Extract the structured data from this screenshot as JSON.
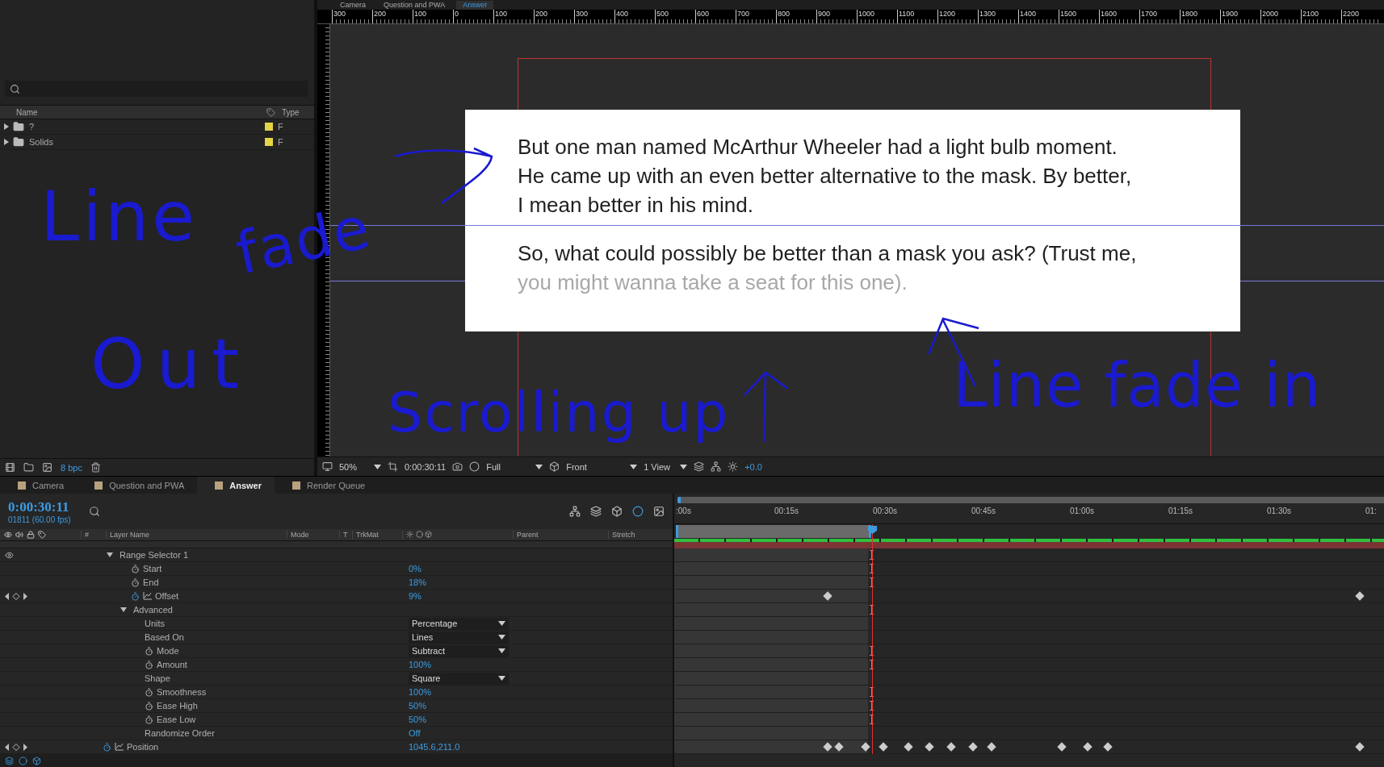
{
  "project": {
    "columns": [
      {
        "label": "Name"
      },
      {
        "label": "Type"
      }
    ],
    "items": [
      {
        "name": "?",
        "type": "F",
        "expanded": false
      },
      {
        "name": "Solids",
        "type": "F",
        "expanded": false
      }
    ],
    "bit_depth": "8 bpc"
  },
  "viewer": {
    "tabs": [
      {
        "label": "Camera",
        "selected": false
      },
      {
        "label": "Question and PWA",
        "selected": false
      },
      {
        "label": "Answer",
        "selected": true
      }
    ],
    "ruler": [
      "300",
      "200",
      "100",
      "0",
      "100",
      "200",
      "300",
      "400",
      "500",
      "600",
      "700",
      "800",
      "900",
      "1000",
      "1100",
      "1200",
      "1300",
      "1400",
      "1500",
      "1600",
      "1700",
      "1800",
      "1900",
      "2000",
      "2100",
      "2200"
    ],
    "paragraphs": [
      {
        "lines": [
          {
            "text": "But one man named McArthur Wheeler had a light bulb moment.",
            "faded": false
          },
          {
            "text": "He came up with an even better alternative to the mask. By better,",
            "faded": false
          },
          {
            "text": "I mean better in his mind.",
            "faded": false
          }
        ]
      },
      {
        "lines": [
          {
            "text": "So, what could possibly be better than a mask you ask? (Trust me,",
            "faded": false
          },
          {
            "text": "you might wanna take a seat for this one).",
            "faded": true
          }
        ]
      }
    ],
    "toolbar": {
      "zoom": "50%",
      "time": "0:00:30:11",
      "resolution": "Full",
      "view": "Front",
      "layout": "1 View",
      "exposure": "+0.0"
    }
  },
  "annotations": [
    {
      "text": "Line"
    },
    {
      "text": "fade"
    },
    {
      "text": "Out"
    },
    {
      "text": "Scrolling up"
    },
    {
      "text": "Line fade in"
    }
  ],
  "timeline": {
    "tabs": [
      {
        "label": "Camera",
        "selected": false
      },
      {
        "label": "Question and PWA",
        "selected": false
      },
      {
        "label": "Answer",
        "selected": true
      },
      {
        "label": "Render Queue",
        "selected": false
      }
    ],
    "time": "0:00:30:11",
    "frame": "01811 (60.00 fps)",
    "columns": [
      {
        "label": "#"
      },
      {
        "label": "Layer Name"
      },
      {
        "label": "Mode"
      },
      {
        "label": "T"
      },
      {
        "label": "TrkMat"
      },
      {
        "label": "Parent"
      },
      {
        "label": "Stretch"
      }
    ],
    "ruler": [
      ":00s",
      "00:15s",
      "00:30s",
      "00:45s",
      "01:00s",
      "01:15s",
      "01:30s",
      "01:"
    ],
    "properties": [
      {
        "name": "Range Selector 1",
        "kind": "group",
        "expanded": true,
        "children": [
          {
            "name": "Start",
            "kind": "value",
            "value": "0%",
            "stopwatch": true,
            "animated": false
          },
          {
            "name": "End",
            "kind": "value",
            "value": "18%",
            "stopwatch": true,
            "animated": false
          },
          {
            "name": "Offset",
            "kind": "value",
            "value": "9%",
            "stopwatch": true,
            "animated": true
          },
          {
            "name": "Advanced",
            "kind": "group",
            "expanded": true,
            "children": [
              {
                "name": "Units",
                "kind": "dropdown",
                "value": "Percentage",
                "stopwatch": false
              },
              {
                "name": "Based On",
                "kind": "dropdown",
                "value": "Lines",
                "stopwatch": false
              },
              {
                "name": "Mode",
                "kind": "dropdown",
                "value": "Subtract",
                "stopwatch": true,
                "animated": false
              },
              {
                "name": "Amount",
                "kind": "value",
                "value": "100%",
                "stopwatch": true,
                "animated": false
              },
              {
                "name": "Shape",
                "kind": "dropdown",
                "value": "Square",
                "stopwatch": false
              },
              {
                "name": "Smoothness",
                "kind": "value",
                "value": "100%",
                "stopwatch": true,
                "animated": false
              },
              {
                "name": "Ease High",
                "kind": "value",
                "value": "50%",
                "stopwatch": true,
                "animated": false
              },
              {
                "name": "Ease Low",
                "kind": "value",
                "value": "50%",
                "stopwatch": true,
                "animated": false
              },
              {
                "name": "Randomize Order",
                "kind": "value",
                "value": "Off",
                "stopwatch": false
              }
            ]
          }
        ]
      },
      {
        "name": "Position",
        "kind": "value",
        "value": "1045.6,211.0",
        "stopwatch": true,
        "animated": true
      }
    ]
  }
}
